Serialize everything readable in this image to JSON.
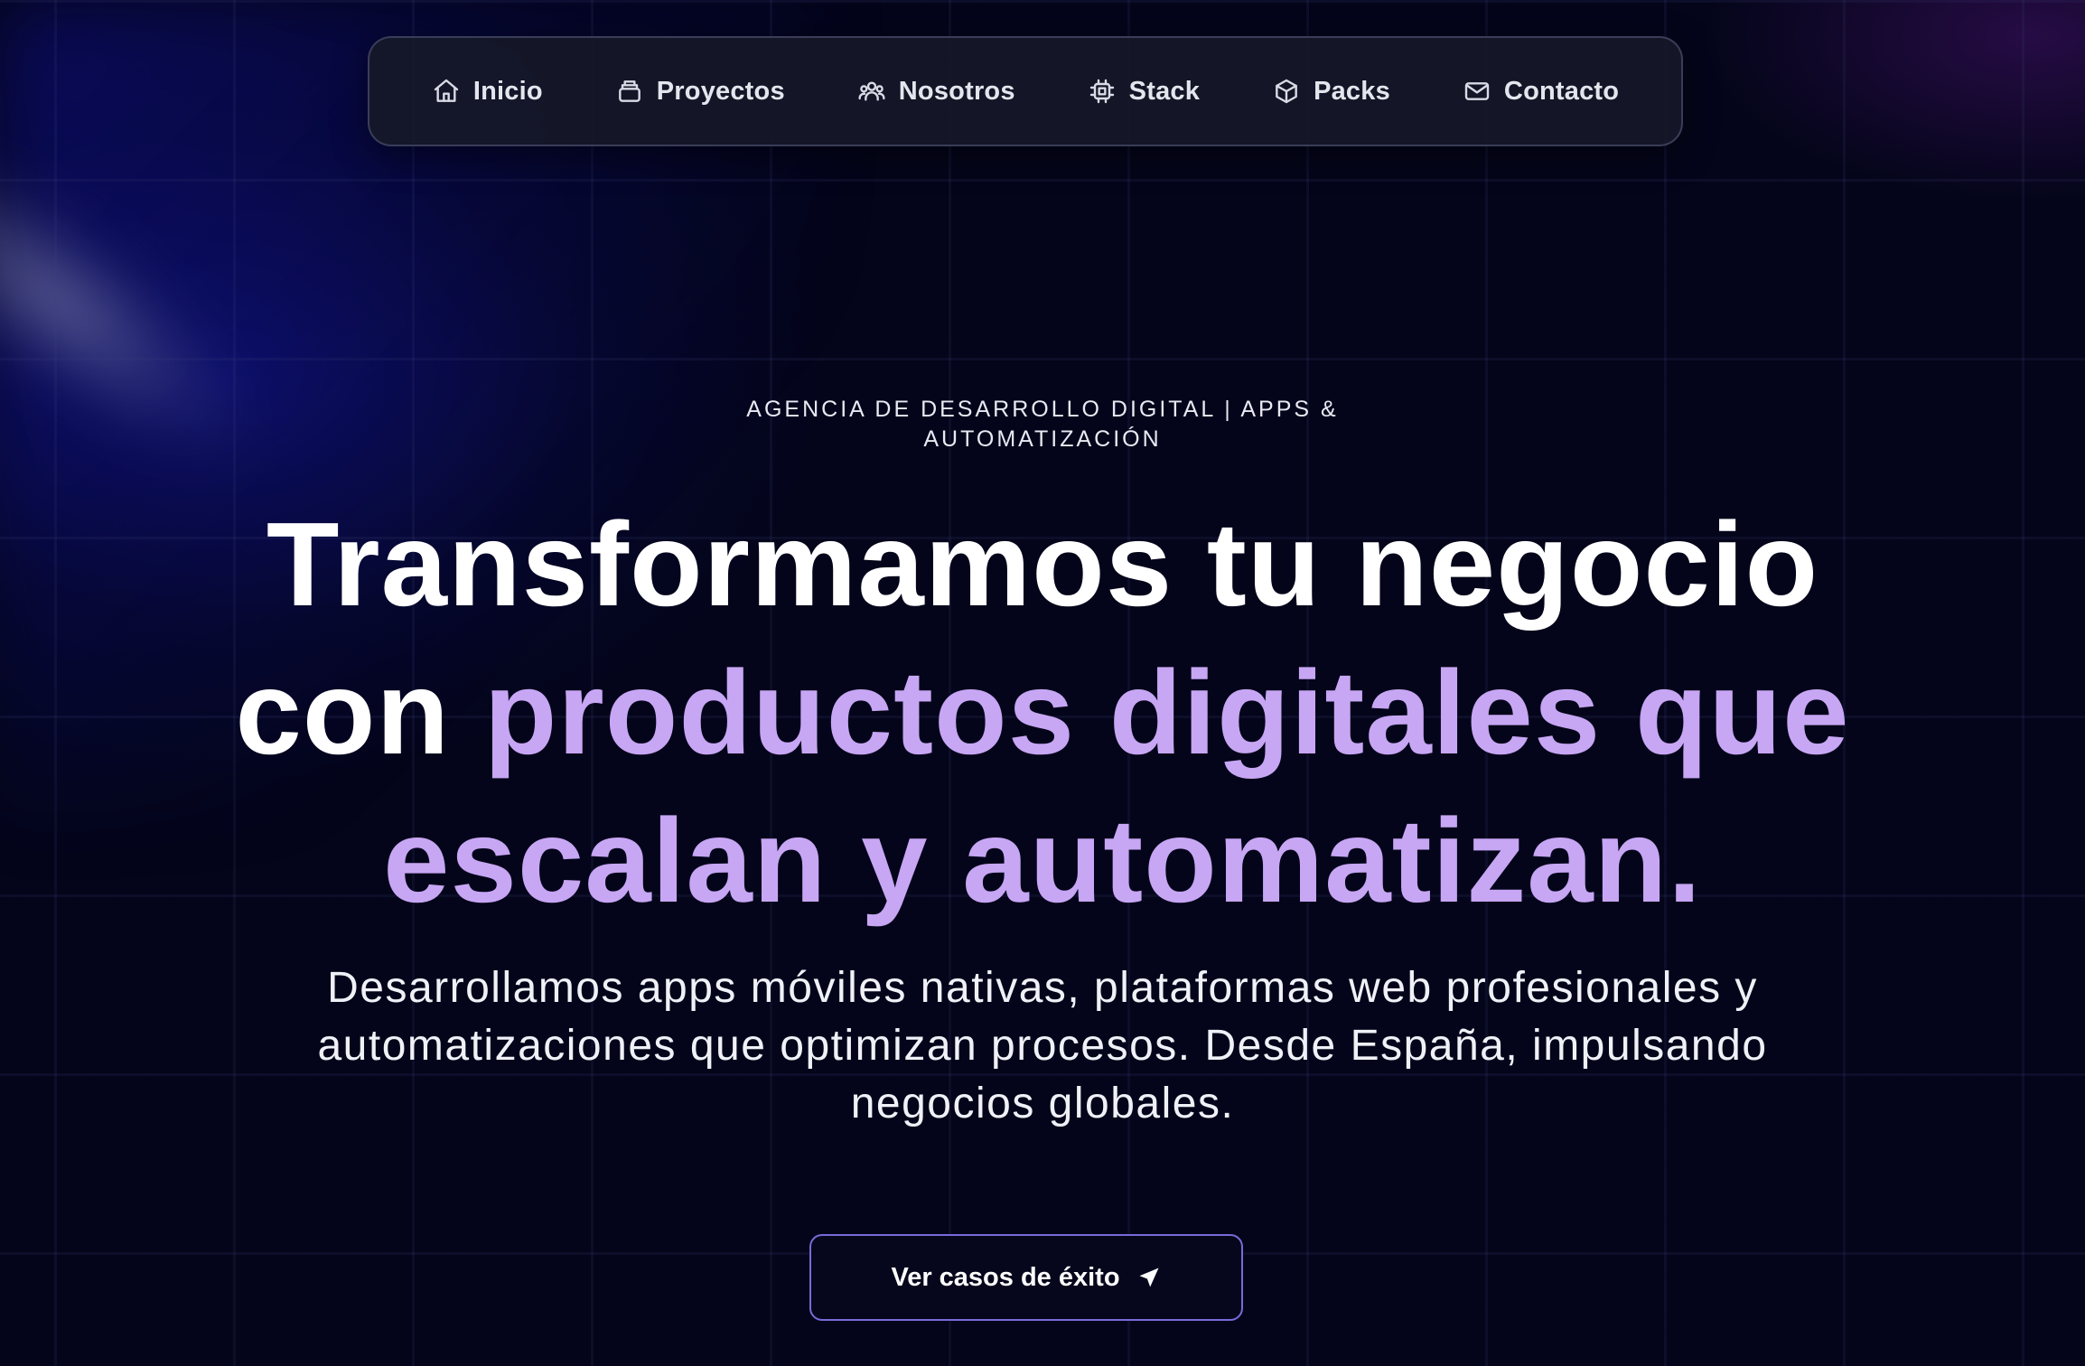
{
  "nav": {
    "items": [
      {
        "label": "Inicio",
        "icon": "home-icon"
      },
      {
        "label": "Proyectos",
        "icon": "archive-icon"
      },
      {
        "label": "Nosotros",
        "icon": "users-icon"
      },
      {
        "label": "Stack",
        "icon": "chip-icon"
      },
      {
        "label": "Packs",
        "icon": "box-icon"
      },
      {
        "label": "Contacto",
        "icon": "mail-icon"
      }
    ]
  },
  "hero": {
    "eyebrow": "AGENCIA DE DESARROLLO DIGITAL | APPS & AUTOMATIZACIÓN",
    "headline_part1": "Transformamos tu negocio con ",
    "headline_accent": "productos digitales que escalan y automatizan.",
    "subtitle": "Desarrollamos apps móviles nativas, plataformas web profesionales y automatizaciones que optimizan procesos. Desde España, impulsando negocios globales.",
    "cta_label": "Ver casos de éxito",
    "cta_icon": "send-arrow-icon"
  },
  "colors": {
    "background": "#04051a",
    "accent": "#c7a6f4",
    "cta_border": "#7a6ad8"
  }
}
